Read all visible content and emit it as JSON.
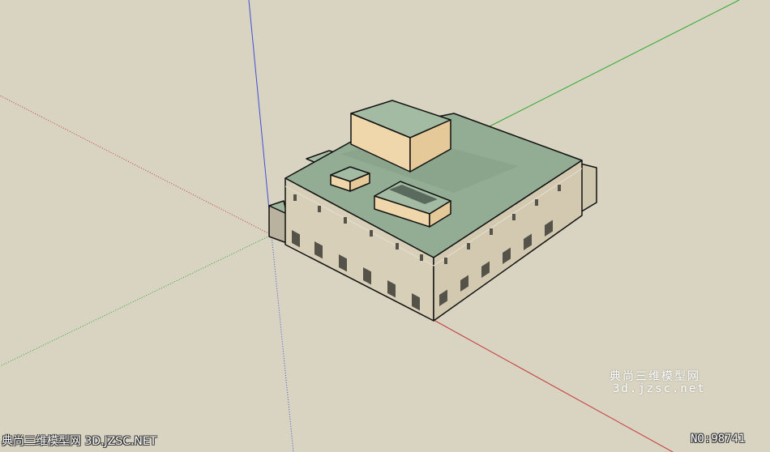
{
  "scene": {
    "background_color": "#d9d4c2",
    "axis_colors": {
      "blue": "#3d4fd6",
      "green": "#2fa82f",
      "red": "#c43a3a"
    },
    "roof_color": "#93ad94",
    "wall_color": "#d8cfb8",
    "parapet_color": "#efd7ab"
  },
  "watermark": {
    "site_name": "典尚三维模型网",
    "site_url": "3d.jzsc.net"
  },
  "footer": {
    "left_text": "典尚三维模型网 3D.JZSC.NET",
    "right_text": "NO:98741"
  }
}
